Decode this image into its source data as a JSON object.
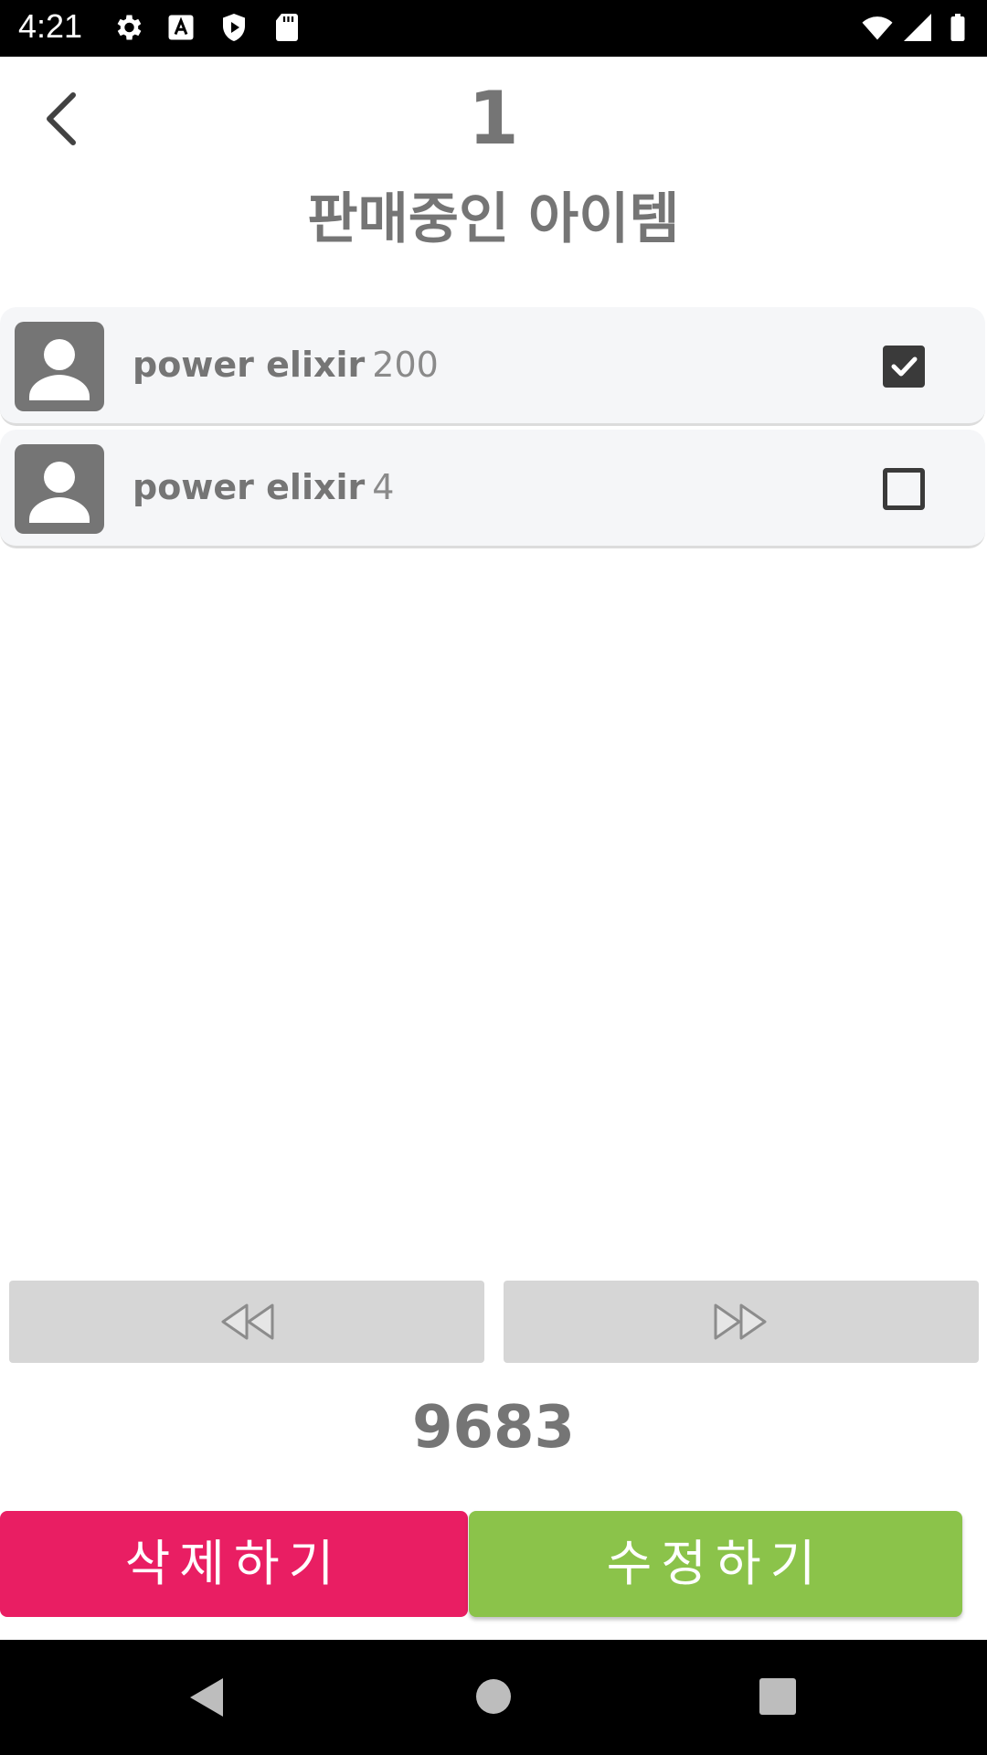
{
  "status_bar": {
    "time": "4:21",
    "icons": [
      "gear-icon",
      "text-a-icon",
      "shield-play-icon",
      "sd-card-icon",
      "wifi-icon",
      "signal-icon",
      "battery-icon"
    ]
  },
  "header": {
    "back_icon": "chevron-left-icon",
    "page_number": "1",
    "title": "판매중인 아이템"
  },
  "items": [
    {
      "name": "power elixir",
      "quantity": "200",
      "checked": true,
      "icon": "person-icon"
    },
    {
      "name": "power elixir",
      "quantity": "4",
      "checked": false,
      "icon": "person-icon"
    }
  ],
  "pagination": {
    "prev_icon": "rewind-icon",
    "next_icon": "fast-forward-icon"
  },
  "total_value": "9683",
  "actions": {
    "delete_label": "삭제하기",
    "edit_label": "수정하기",
    "delete_color": "#e91e63",
    "edit_color": "#8bc34a"
  },
  "nav_bar": {
    "icons": [
      "back-triangle-icon",
      "home-circle-icon",
      "recents-square-icon"
    ]
  }
}
